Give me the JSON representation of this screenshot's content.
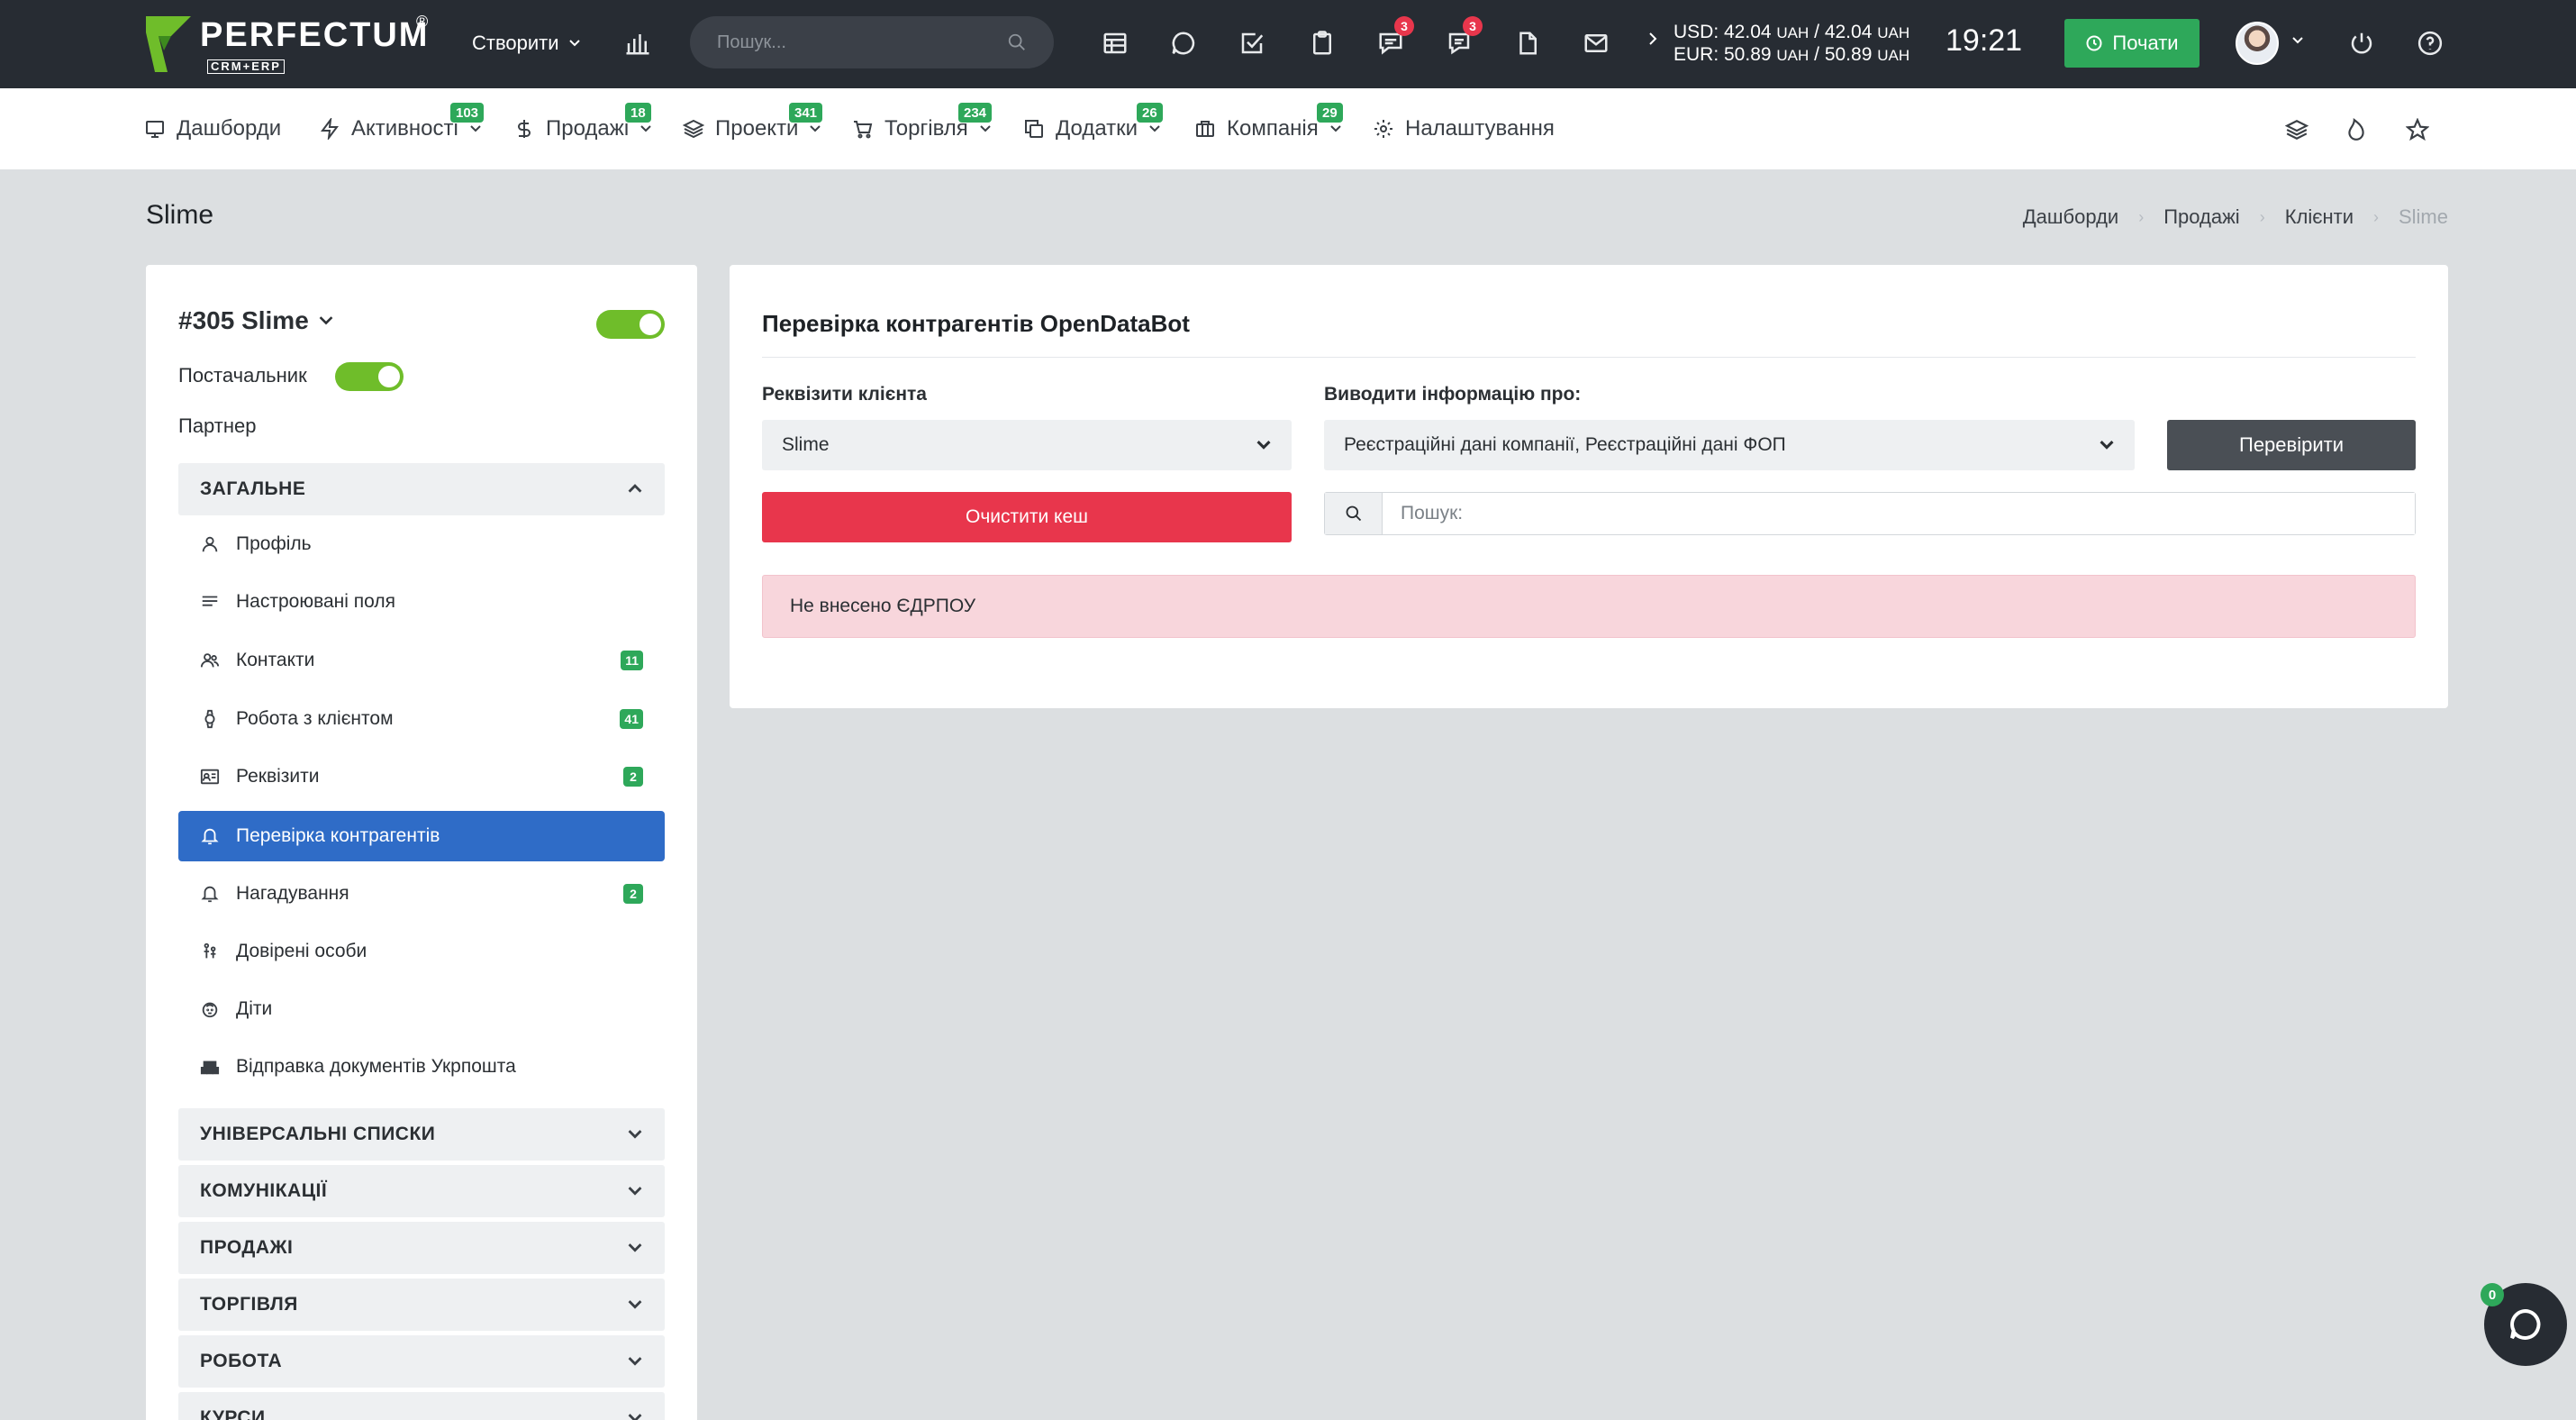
{
  "brand": {
    "name": "PERFECTUM",
    "registered": "®",
    "subtitle": "CRM+ERP"
  },
  "topbar": {
    "create_label": "Створити",
    "search_placeholder": "Пошук...",
    "chat_badge": "3",
    "messages_badge": "3",
    "rates": {
      "usd": "USD: 42.04",
      "usd_unit1": "UAH",
      "usd_sep": "/ 42.04",
      "usd_unit2": "UAH",
      "eur": "EUR: 50.89",
      "eur_unit1": "UAH",
      "eur_sep": "/ 50.89",
      "eur_unit2": "UAH"
    },
    "time": "19:21",
    "start_label": "Почати",
    "icons": [
      "chart-bar-icon",
      "table-icon",
      "chat-bubble-icon",
      "checkbox-icon",
      "clipboard-icon",
      "comments-icon",
      "messages-icon",
      "document-icon",
      "envelope-icon",
      "power-icon",
      "help-icon"
    ]
  },
  "nav": {
    "items": [
      {
        "label": "Дашборди",
        "badge": ""
      },
      {
        "label": "Активності",
        "badge": "103"
      },
      {
        "label": "Продажі",
        "badge": "18"
      },
      {
        "label": "Проекти",
        "badge": "341"
      },
      {
        "label": "Торгівля",
        "badge": "234"
      },
      {
        "label": "Додатки",
        "badge": "26"
      },
      {
        "label": "Компанія",
        "badge": "29"
      },
      {
        "label": "Налаштування",
        "badge": ""
      }
    ]
  },
  "page": {
    "title": "Slime",
    "breadcrumb": [
      "Дашборди",
      "Продажі",
      "Клієнти",
      "Slime"
    ]
  },
  "sidebar": {
    "client_title": "#305 Slime",
    "supplier_label": "Постачальник",
    "partner_label": "Партнер",
    "general_section": "ЗАГАЛЬНЕ",
    "items": [
      {
        "label": "Профіль",
        "badge": ""
      },
      {
        "label": "Настроювані поля",
        "badge": ""
      },
      {
        "label": "Контакти",
        "badge": "11"
      },
      {
        "label": "Робота з клієнтом",
        "badge": "41"
      },
      {
        "label": "Реквізити",
        "badge": "2"
      },
      {
        "label": "Перевірка контрагентів",
        "badge": ""
      },
      {
        "label": "Нагадування",
        "badge": "2"
      },
      {
        "label": "Довірені особи",
        "badge": ""
      },
      {
        "label": "Діти",
        "badge": ""
      },
      {
        "label": "Відправка документів Укрпошта",
        "badge": ""
      }
    ],
    "sections": [
      "УНІВЕРСАЛЬНІ СПИСКИ",
      "КОМУНІКАЦІЇ",
      "ПРОДАЖІ",
      "ТОРГІВЛЯ",
      "РОБОТА",
      "КУРСИ"
    ]
  },
  "main": {
    "title": "Перевірка контрагентів OpenDataBot",
    "requisites_label": "Реквізити клієнта",
    "requisites_value": "Slime",
    "info_label": "Виводити інформацію про:",
    "info_value": "Реєстраційні дані компанії, Реєстраційні дані ФОП",
    "check_button": "Перевірити",
    "clear_cache_button": "Очистити кеш",
    "search_placeholder": "Пошук:",
    "alert": "Не внесено ЄДРПОУ"
  },
  "chat": {
    "badge": "0"
  },
  "colors": {
    "topbar": "#272c33",
    "accent_green": "#2ea85a",
    "active_blue": "#2f6cc7",
    "danger": "#e8364c",
    "toggle_green": "#6fbd2a",
    "alert_bg": "#f8d6dc"
  }
}
